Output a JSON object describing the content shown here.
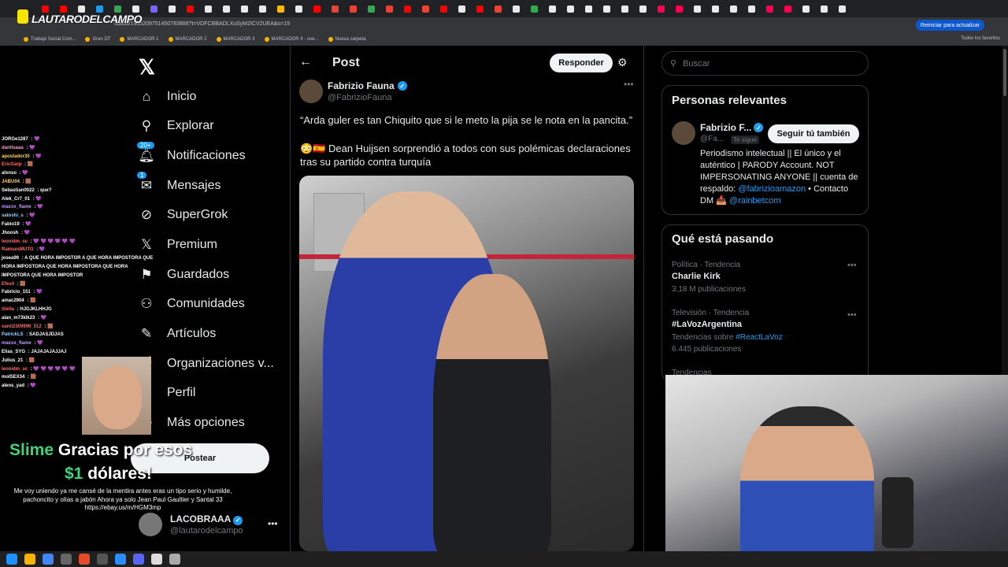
{
  "browser": {
    "url": "status/1965209751450783888?t=VDFCBBADLXuSyM2ICV2UEA&s=19",
    "update_button": "Reiniciar para actualizar",
    "bookmarks": [
      "Trabajo Social Com...",
      "Gran DT",
      "MARCADOR 1",
      "MARCADOR 2",
      "MARCADOR 3",
      "MARCADOR 4 - ove...",
      "Nueva carpeta"
    ],
    "all_bookmarks": "Todos los favoritos"
  },
  "stream": {
    "brand": "LAUTARODELCAMPO",
    "chat": [
      {
        "user": "JORGe1287",
        "msg": "💜",
        "color": "#ffffff"
      },
      {
        "user": "danitsaaa",
        "msg": "💜",
        "color": "#ff9bd1"
      },
      {
        "user": "apostador30",
        "msg": "💜",
        "color": "#ffd36a"
      },
      {
        "user": "EricGarp",
        "msg": "🟫",
        "color": "#ff6b6b"
      },
      {
        "user": "alxnso",
        "msg": "💜",
        "color": "#ffffff"
      },
      {
        "user": "JABU04",
        "msg": "🟫",
        "color": "#ffd36a"
      },
      {
        "user": "Sebastian0022",
        "msg": "que?",
        "color": "#ffffff"
      },
      {
        "user": "Alek_Cr7_01",
        "msg": "💜",
        "color": "#ffffff"
      },
      {
        "user": "maxxx_flame",
        "msg": "💜",
        "color": "#c39bff"
      },
      {
        "user": "satoshi_s",
        "msg": "💜",
        "color": "#9bd1ff"
      },
      {
        "user": "Fabio19",
        "msg": "💜",
        "color": "#ffffff"
      },
      {
        "user": "Jhoosh",
        "msg": "💜",
        "color": "#ffffff"
      },
      {
        "user": "leonidm_sc",
        "msg": "💜 💜 💜 💜 💜 💜",
        "color": "#ff6b6b"
      },
      {
        "user": "RamsesMUTO",
        "msg": "💜",
        "color": "#ff6b6b"
      },
      {
        "user": "josea99",
        "msg": "A QUE HORA IMPOSTOR A QUE HORA IMPOSTORA QUE HORA IMPOSTORA QUE HORA IMPOSTORA QUE HORA IMPOSTORA QUE HORA IMPOSTOR",
        "color": "#ffffff"
      },
      {
        "user": "Efes4",
        "msg": "🟫",
        "color": "#ff6b6b"
      },
      {
        "user": "Fabricio_151",
        "msg": "💜",
        "color": "#ffffff"
      },
      {
        "user": "amac2904",
        "msg": "🟫",
        "color": "#ffffff"
      },
      {
        "user": "Stella",
        "msg": "HJGJKLHHJG",
        "color": "#ff6b6b"
      },
      {
        "user": "alan_m73klk23",
        "msg": "💜",
        "color": "#ffffff"
      },
      {
        "user": "santi2309990_512",
        "msg": "🟫",
        "color": "#ff6b6b"
      },
      {
        "user": "PatrickLS",
        "msg": "SADJASJDJAS",
        "color": "#9bd1ff"
      },
      {
        "user": "maxxx_flame",
        "msg": "💜",
        "color": "#c39bff"
      },
      {
        "user": "Elias_SYG",
        "msg": "JAJAJAJAJJAJ",
        "color": "#ffffff"
      },
      {
        "user": "Julius_21",
        "msg": "🟫",
        "color": "#ffffff"
      },
      {
        "user": "leonidm_sc",
        "msg": "💜 💜 💜 💜 💜 💜",
        "color": "#ff6b6b"
      },
      {
        "user": "moISEX34",
        "msg": "🟫",
        "color": "#ffffff"
      },
      {
        "user": "aleos_yad",
        "msg": "💜",
        "color": "#ffffff"
      }
    ],
    "donation_line1_accent": "Slime",
    "donation_line1_rest": "Gracias por esos",
    "donation_line2_accent": "$1",
    "donation_line2_rest": "dólares!",
    "donation_message": "Me voy uniendo ya me cansé de la mentira antes eras un tipo serio y humilde, pachoncito y olías a jabón Ahora ya solo Jean Paul Gaultier y Santal 33 https://ebay.us/m/HGM3mp"
  },
  "nav": {
    "items": [
      {
        "label": "Inicio",
        "icon": "home-icon",
        "glyph": "⌂"
      },
      {
        "label": "Explorar",
        "icon": "search-icon",
        "glyph": "⚲"
      },
      {
        "label": "Notificaciones",
        "icon": "bell-icon",
        "glyph": "🔔︎",
        "badge": "20+"
      },
      {
        "label": "Mensajes",
        "icon": "mail-icon",
        "glyph": "✉",
        "badge": "1"
      },
      {
        "label": "SuperGrok",
        "icon": "grok-icon",
        "glyph": "⊘"
      },
      {
        "label": "Premium",
        "icon": "x-icon",
        "glyph": "𝕏"
      },
      {
        "label": "Guardados",
        "icon": "bookmark-icon",
        "glyph": "⚑"
      },
      {
        "label": "Comunidades",
        "icon": "community-icon",
        "glyph": "⚇"
      },
      {
        "label": "Artículos",
        "icon": "article-icon",
        "glyph": "✎"
      },
      {
        "label": "Organizaciones v...",
        "icon": "organization-icon",
        "glyph": "⚡"
      },
      {
        "label": "Perfil",
        "icon": "profile-icon",
        "glyph": "☺"
      },
      {
        "label": "Más opciones",
        "icon": "more-icon",
        "glyph": "⋯"
      }
    ],
    "post_button": "Postear",
    "profile_name": "LACOBRAAA",
    "profile_handle": "@lautarodelcampo"
  },
  "post": {
    "header_title": "Post",
    "reply_button": "Responder",
    "author_name": "Fabrizio Fauna",
    "author_handle": "@FabrizioFauna",
    "text1": "“Arda guler es tan Chiquito que si le meto la pija se le nota en la pancita.”",
    "text2": "😳🇪🇸 Dean Huijsen sorprendió a todos con sus polémicas declaraciones tras su partido contra turquía"
  },
  "right": {
    "search_placeholder": "Buscar",
    "relevant_title": "Personas relevantes",
    "rel_name": "Fabrizio F...",
    "rel_handle": "@Fa...",
    "rel_follows_you": "Te sigue",
    "rel_follow_button": "Seguir tú también",
    "rel_bio_text": "Periodismo intelectual || El único y el auténtico | PARODY Account. NOT IMPERSONATING ANYONE || cuenta de respaldo:",
    "rel_bio_link1": "@fabrizioamazon",
    "rel_bio_mid": "• Contacto DM 📥",
    "rel_bio_link2": "@rainbetcom",
    "trends_title": "Qué está pasando",
    "trends": [
      {
        "meta": "Política · Tendencia",
        "name": "Charlie Kirk",
        "count": "3,18 M publicaciones"
      },
      {
        "meta": "Televisión · Tendencia",
        "name": "#LaVozArgentina",
        "sub_prefix": "Tendencias sobre",
        "sub_link": "#ReactLaVoz",
        "count": "6.445 publicaciones"
      },
      {
        "meta": "Tendencias",
        "name": "",
        "count": ""
      }
    ]
  },
  "colors": {
    "accent": "#1d9bf0",
    "background": "#000000",
    "border": "#2f3336",
    "secondary_text": "#71767b"
  }
}
